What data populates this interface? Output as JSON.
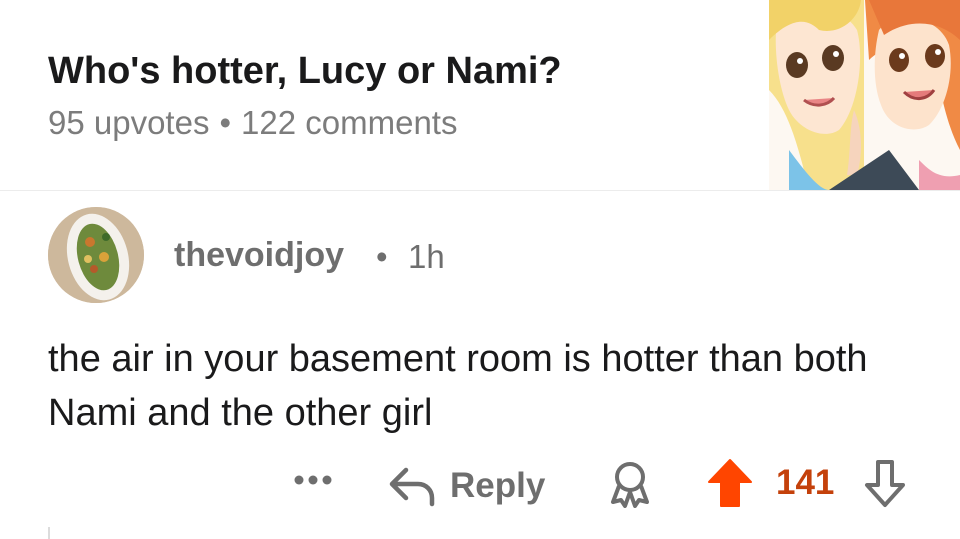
{
  "post": {
    "title": "Who's hotter, Lucy or Nami?",
    "upvotes": "95 upvotes",
    "separator": "•",
    "comments": "122 comments",
    "thumbnail_icon": "gallery-icon"
  },
  "comment": {
    "username": "thevoidjoy",
    "separator": "•",
    "age": "1h",
    "body": "the air in your basement room is hotter than both Nami and the other girl",
    "actions": {
      "more_icon": "more-icon",
      "reply_label": "Reply",
      "award_icon": "award-icon",
      "upvote_icon": "upvote-icon",
      "score": "141",
      "downvote_icon": "downvote-icon"
    }
  },
  "colors": {
    "upvote_active": "#ff4500",
    "score": "#c4410b",
    "muted": "#7c7c7c"
  }
}
